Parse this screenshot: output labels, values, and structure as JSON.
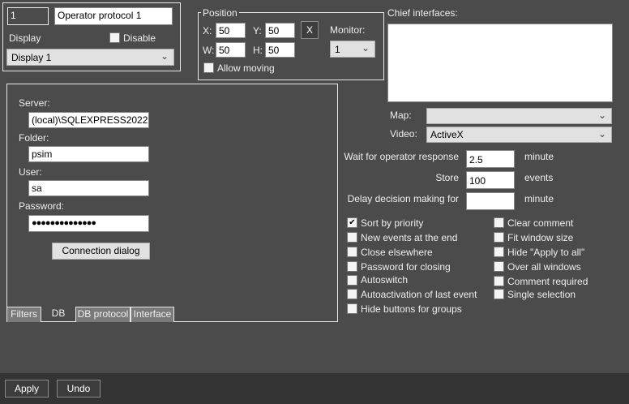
{
  "header": {
    "id_value": "1",
    "name_value": "Operator protocol 1",
    "display_label": "Display",
    "disable_label": "Disable",
    "display_select": "Display 1"
  },
  "position": {
    "title": "Position",
    "x_label": "X:",
    "y_label": "Y:",
    "w_label": "W:",
    "h_label": "H:",
    "x": "50",
    "y": "50",
    "w": "50",
    "h": "50",
    "reset_label": "X",
    "monitor_label": "Monitor:",
    "monitor_value": "1",
    "allow_moving_label": "Allow moving"
  },
  "chief": {
    "label": "Chief interfaces:"
  },
  "map": {
    "label": "Map:",
    "value": ""
  },
  "video": {
    "label": "Video:",
    "value": "ActiveX"
  },
  "settings": {
    "wait_label": "Wait for operator response",
    "wait_value": "2.5",
    "wait_unit": "minute",
    "store_label": "Store",
    "store_value": "100",
    "store_unit": "events",
    "delay_label": "Delay decision making for",
    "delay_value": "",
    "delay_unit": "minute"
  },
  "options_left": [
    {
      "label": "Sort by priority",
      "checked": true
    },
    {
      "label": "New events at the end"
    },
    {
      "label": "Close elsewhere"
    },
    {
      "label": "Password for closing"
    },
    {
      "label": "Autoswitch"
    },
    {
      "label": "Autoactivation of last event"
    },
    {
      "label": "Hide buttons for groups"
    }
  ],
  "options_right": [
    {
      "label": "Clear comment"
    },
    {
      "label": "Fit window size"
    },
    {
      "label": "Hide \"Apply to all\""
    },
    {
      "label": "Over all windows"
    },
    {
      "label": "Comment required"
    },
    {
      "label": "Single selection"
    }
  ],
  "db": {
    "server_label": "Server:",
    "server_value": "(local)\\SQLEXPRESS2022",
    "folder_label": "Folder:",
    "folder_value": "psim",
    "user_label": "User:",
    "user_value": "sa",
    "password_label": "Password:",
    "password_value": "●●●●●●●●●●●●●●",
    "connection_button": "Connection dialog"
  },
  "tabs": [
    "Filters",
    "DB",
    "DB protocol",
    "Interface"
  ],
  "footer": {
    "apply": "Apply",
    "undo": "Undo"
  }
}
